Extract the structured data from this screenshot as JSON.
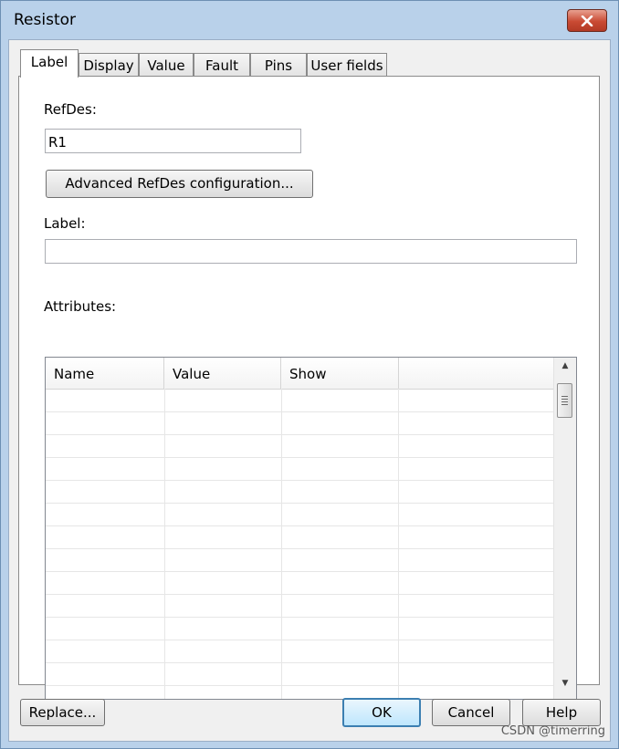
{
  "window": {
    "title": "Resistor"
  },
  "tabs": [
    {
      "label": "Label",
      "active": true
    },
    {
      "label": "Display",
      "active": false
    },
    {
      "label": "Value",
      "active": false
    },
    {
      "label": "Fault",
      "active": false
    },
    {
      "label": "Pins",
      "active": false
    },
    {
      "label": "User fields",
      "active": false
    }
  ],
  "label_tab": {
    "refdes_label": "RefDes:",
    "refdes_value": "R1",
    "advanced_button": "Advanced RefDes configuration...",
    "label_label": "Label:",
    "label_value": "",
    "attributes_label": "Attributes:",
    "attributes_columns": [
      "Name",
      "Value",
      "Show"
    ]
  },
  "buttons": {
    "replace": "Replace...",
    "ok": "OK",
    "cancel": "Cancel",
    "help": "Help"
  },
  "watermark": "CSDN @timerring"
}
